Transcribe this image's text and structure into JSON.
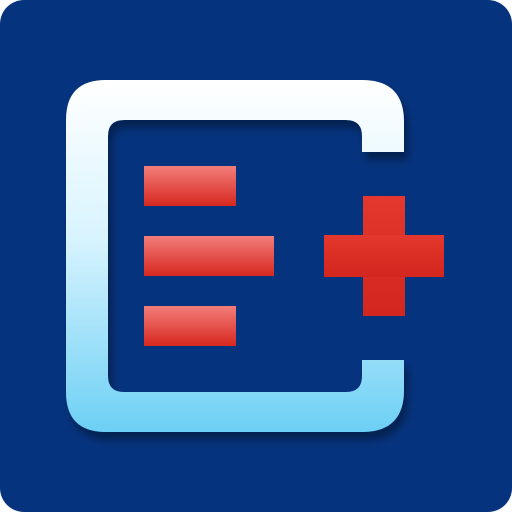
{
  "icon": {
    "name": "add-note-app-icon",
    "colors": {
      "background": "#06337D",
      "frame_light": "#FFFFFF",
      "frame_mid": "#C9F0FF",
      "frame_dark": "#6FD0F5",
      "bar_top": "#F07A78",
      "bar_bottom": "#D92A20",
      "plus": "#DD2E26"
    },
    "glyphs": [
      "frame-icon",
      "text-lines-icon",
      "plus-icon"
    ]
  }
}
